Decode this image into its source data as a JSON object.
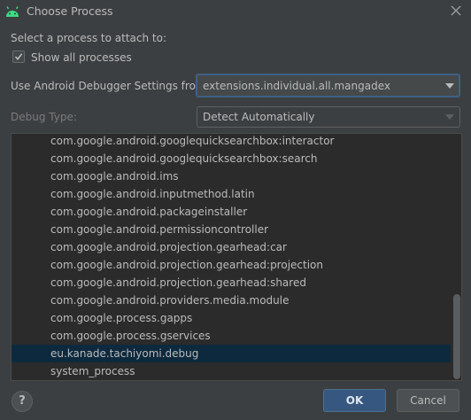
{
  "window": {
    "title": "Choose Process"
  },
  "select_label": "Select a process to attach to:",
  "show_all": {
    "label": "Show all processes",
    "checked": true
  },
  "debugger_settings": {
    "label": "Use Android Debugger Settings from:",
    "value": "extensions.individual.all.mangadex"
  },
  "debug_type": {
    "label": "Debug Type:",
    "value": "Detect Automatically"
  },
  "processes": [
    "com.google.android.googlequicksearchbox:interactor",
    "com.google.android.googlequicksearchbox:search",
    "com.google.android.ims",
    "com.google.android.inputmethod.latin",
    "com.google.android.packageinstaller",
    "com.google.android.permissioncontroller",
    "com.google.android.projection.gearhead:car",
    "com.google.android.projection.gearhead:projection",
    "com.google.android.projection.gearhead:shared",
    "com.google.android.providers.media.module",
    "com.google.process.gapps",
    "com.google.process.gservices",
    "eu.kanade.tachiyomi.debug",
    "system_process"
  ],
  "selected_process": "eu.kanade.tachiyomi.debug",
  "buttons": {
    "help": "?",
    "ok": "OK",
    "cancel": "Cancel"
  },
  "colors": {
    "accent": "#365880",
    "selection": "#0d293e",
    "android_green": "#3ddc84"
  }
}
